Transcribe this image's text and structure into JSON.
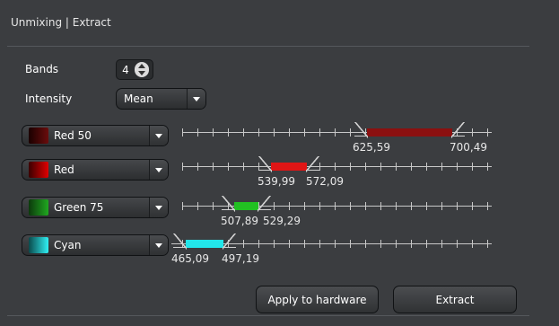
{
  "panel": {
    "title": "Unmixing | Extract"
  },
  "bands": {
    "label": "Bands",
    "value": "4"
  },
  "intensity": {
    "label": "Intensity",
    "value": "Mean"
  },
  "channels": [
    {
      "name": "Red 50",
      "swatch": "#5a0a0a",
      "band_color": "#8b1010",
      "low": "625,59",
      "high": "700,49"
    },
    {
      "name": "Red",
      "swatch": "#d40000",
      "band_color": "#e01515",
      "low": "539,99",
      "high": "572,09"
    },
    {
      "name": "Green 75",
      "swatch": "#1a9a1a",
      "band_color": "#22c022",
      "low": "507,89",
      "high": "529,29"
    },
    {
      "name": "Cyan",
      "swatch": "#20e8ee",
      "band_color": "#22e6ea",
      "low": "465,09",
      "high": "497,19"
    }
  ],
  "buttons": {
    "apply": "Apply to hardware",
    "extract": "Extract"
  }
}
